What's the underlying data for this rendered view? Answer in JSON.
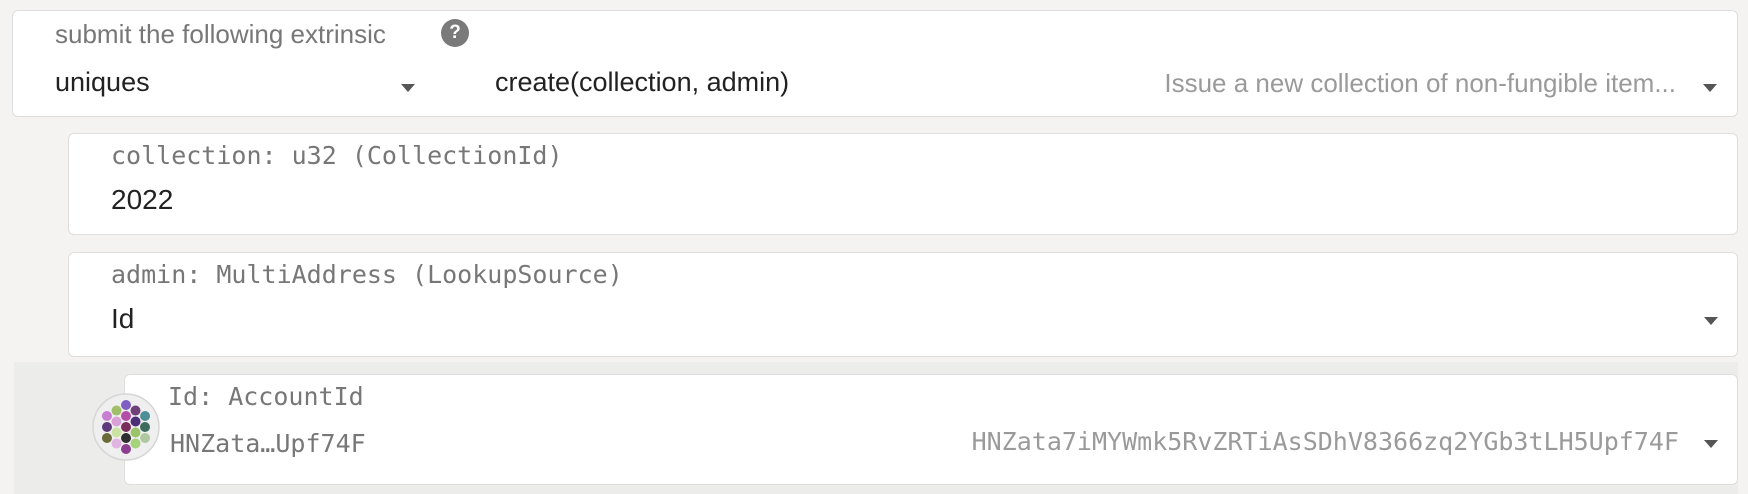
{
  "extrinsic": {
    "label": "submit the following extrinsic",
    "help_icon": "?",
    "pallet": "uniques",
    "call": "create(collection, admin)",
    "description": "Issue a new collection of non-fungible item..."
  },
  "params": {
    "collection": {
      "label": "collection: u32 (CollectionId)",
      "value": "2022"
    },
    "admin": {
      "label": "admin: MultiAddress (LookupSource)",
      "value": "Id",
      "id": {
        "label": "Id: AccountId",
        "short": "HNZata…Upf74F",
        "full": "HNZata7iMYWmk5RvZRTiAsSDhV8366zq2YGb3tLH5Upf74F"
      }
    }
  },
  "colors": {
    "page_bg": "#f4f3f2",
    "box_bg": "#ffffff",
    "border": "#dedede",
    "label_text": "#777777",
    "value_text": "#222222",
    "muted_text": "#9a9a9a"
  },
  "icons": [
    "help-icon",
    "chevron-down-icon",
    "identicon"
  ]
}
